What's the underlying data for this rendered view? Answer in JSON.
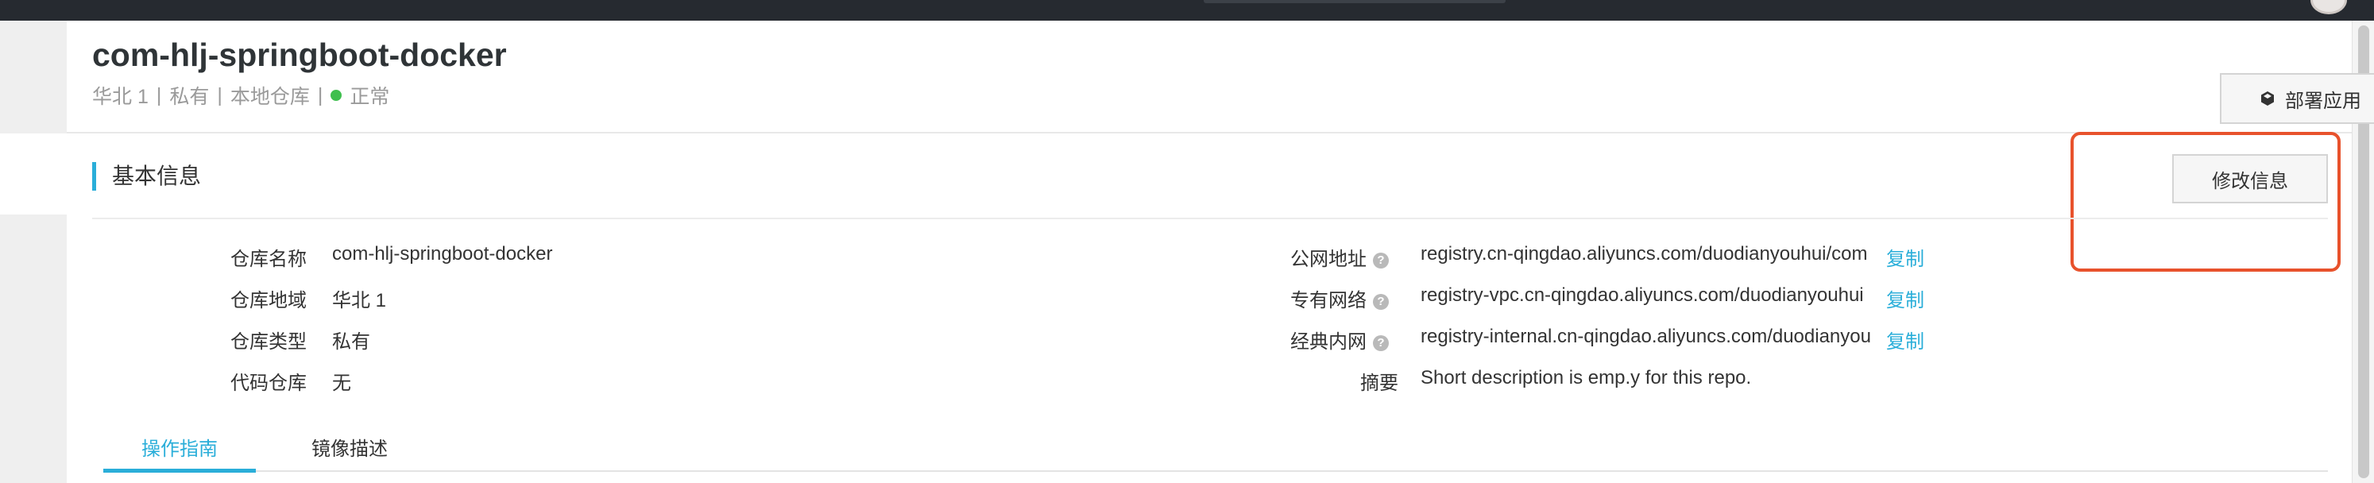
{
  "repo": {
    "title": "com-hlj-springboot-docker",
    "meta": [
      "华北 1",
      "私有",
      "本地仓库"
    ],
    "status": "正常",
    "deploy_button": "部署应用"
  },
  "section": {
    "title": "基本信息",
    "edit_button": "修改信息"
  },
  "info_left": [
    {
      "label": "仓库名称",
      "value": "com-hlj-springboot-docker"
    },
    {
      "label": "仓库地域",
      "value": "华北 1"
    },
    {
      "label": "仓库类型",
      "value": "私有"
    },
    {
      "label": "代码仓库",
      "value": "无"
    }
  ],
  "info_right": [
    {
      "label": "公网地址",
      "value": "registry.cn-qingdao.aliyuncs.com/duodianyouhui/com",
      "copy": "复制"
    },
    {
      "label": "专有网络",
      "value": "registry-vpc.cn-qingdao.aliyuncs.com/duodianyouhui",
      "copy": "复制"
    },
    {
      "label": "经典内网",
      "value": "registry-internal.cn-qingdao.aliyuncs.com/duodianyou",
      "copy": "复制"
    },
    {
      "label": "摘要",
      "value": "Short description is emp.y for this repo."
    }
  ],
  "tabs": [
    "操作指南",
    "镜像描述"
  ],
  "help_glyph": "?",
  "colors": {
    "accent": "#2aaed9",
    "status_ok": "#3fbf4e",
    "highlight": "#e8522c",
    "topbar": "#262a30"
  }
}
